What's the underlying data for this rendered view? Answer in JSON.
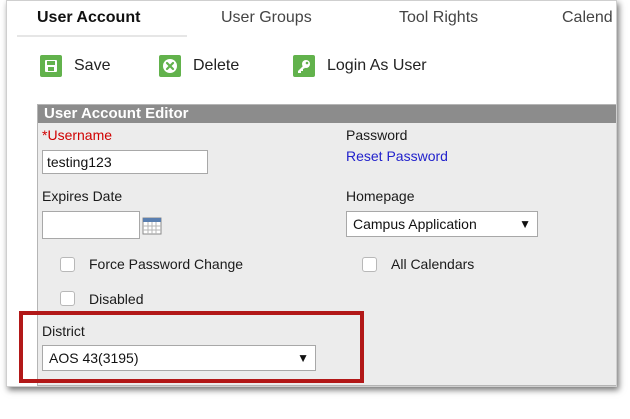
{
  "tabs": [
    {
      "label": "User Account",
      "active": true
    },
    {
      "label": "User Groups",
      "active": false
    },
    {
      "label": "Tool Rights",
      "active": false
    },
    {
      "label": "Calend",
      "active": false
    }
  ],
  "toolbar": {
    "save_label": "Save",
    "delete_label": "Delete",
    "login_label": "Login As User",
    "icon_color": "#62b24c"
  },
  "editor": {
    "title": "User Account Editor",
    "username_required_mark": "*",
    "username_label": "Username",
    "username_value": "testing123",
    "password_label": "Password",
    "reset_password_link": "Reset Password",
    "expires_label": "Expires Date",
    "expires_value": "",
    "homepage_label": "Homepage",
    "homepage_value": "Campus Application",
    "force_password_label": "Force Password Change",
    "force_password_checked": false,
    "all_calendars_label": "All Calendars",
    "all_calendars_checked": false,
    "disabled_label": "Disabled",
    "disabled_checked": false,
    "district_label": "District",
    "district_value": "AOS 43(3195)",
    "dropdown_arrow": "▼"
  },
  "colors": {
    "header_bg": "#8c8c8c",
    "required": "#d00000",
    "link": "#2222cc",
    "highlight": "#b21818"
  }
}
